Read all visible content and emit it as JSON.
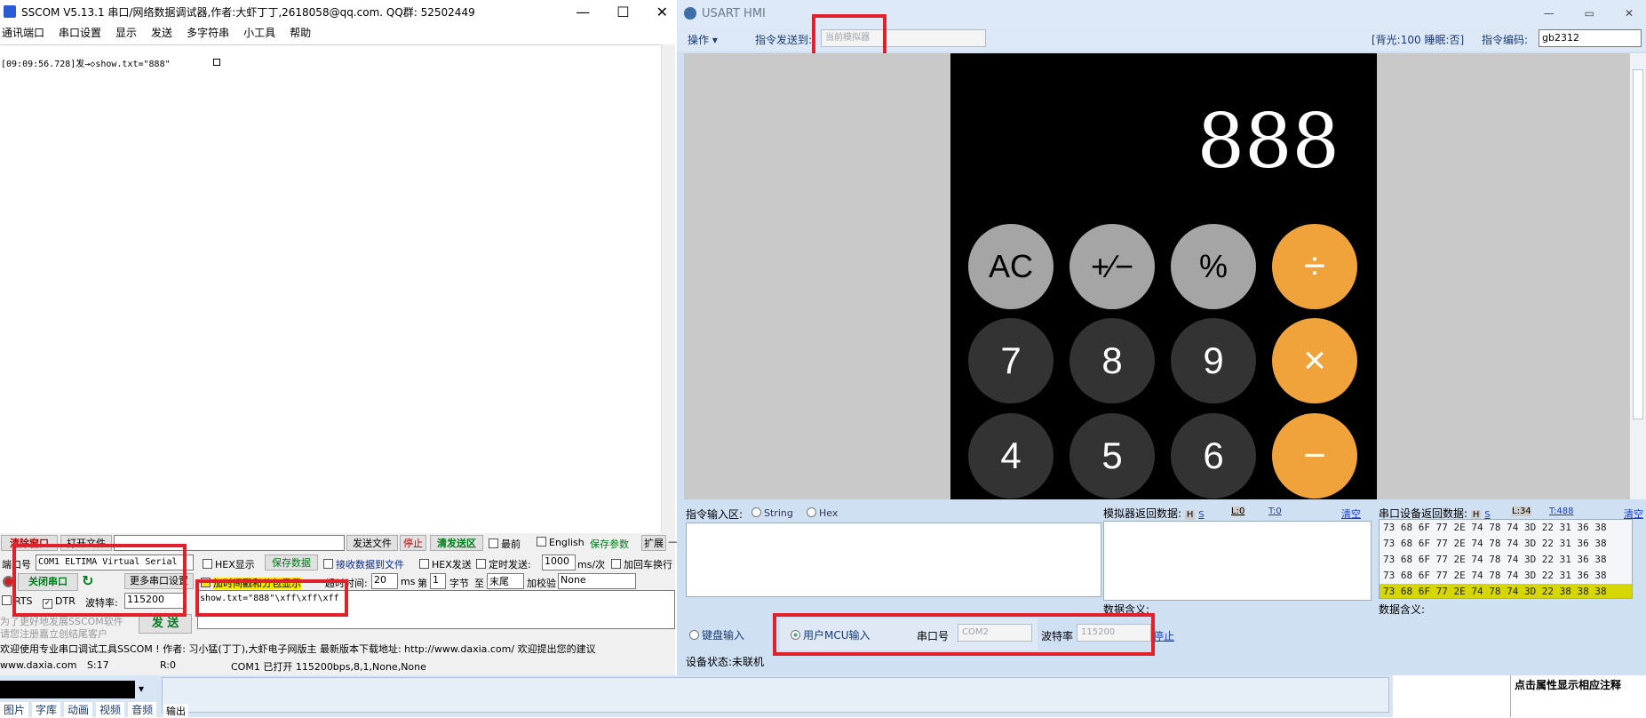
{
  "sscom": {
    "title": "SSCOM V5.13.1 串口/网络数据调试器,作者:大虾丁丁,2618058@qq.com. QQ群: 52502449",
    "menu": [
      "通讯端口",
      "串口设置",
      "显示",
      "发送",
      "多字符串",
      "小工具",
      "帮助"
    ],
    "recv_line": "[09:09:56.728]发→◇show.txt=\"888\"",
    "row1": {
      "clear_window": "清除窗口",
      "open_file": "打开文件",
      "send_file": "发送文件",
      "stop": "停止",
      "clear_send": "清发送区",
      "topmost": "最前",
      "english": "English",
      "save_params": "保存参数",
      "expand": "扩展",
      "dash": "—"
    },
    "port_label": "端口号",
    "port_value": "COM1 ELTIMA Virtual Serial",
    "hex_display": "HEX显示",
    "save_data": "保存数据",
    "recv_to_file": "接收数据到文件",
    "hex_send": "HEX发送",
    "timed_send": "定时发送:",
    "timed_value": "1000",
    "timed_unit": "ms/次",
    "add_crlf": "加回车换行",
    "close_port": "关闭串口",
    "more_settings": "更多串口设置",
    "timestamp_label": "加时间戳和分包显示",
    "timeout_label": "超时时间:",
    "timeout_value": "20",
    "ms": "ms",
    "byte_prefix": "第",
    "byte_value": "1",
    "byte_suffix": "字节",
    "to": "至",
    "to_value": "末尾",
    "checksum_label": "加校验",
    "checksum_value": "None",
    "rts": "RTS",
    "dtr": "DTR",
    "baud_label": "波特率:",
    "baud_value": "115200",
    "send_text": "show.txt=\"888\"\\xff\\xff\\xff",
    "send_button": "发 送",
    "promo1": "为了更好地发展SSCOM软件",
    "promo2": "请您注册嘉立创结尾客户",
    "ticker": "欢迎使用专业串口调试工具SSCOM !  作者: 习小猛(丁丁),大虾电子网版主  最新版本下载地址: http://www.daxia.com/  欢迎提出您的建议",
    "status": {
      "site": "www.daxia.com",
      "sent": "S:17",
      "recv": "R:0",
      "port_state": "COM1 已打开  115200bps,8,1,None,None"
    }
  },
  "hmi": {
    "title": "USART HMI",
    "toolbar": {
      "operate": "操作",
      "send_to_label": "指令发送到:",
      "send_to_value": "当前模拟器",
      "backlight": "[背光:100  睡眠:否]",
      "encoding_label": "指令编码:",
      "encoding_value": "gb2312"
    },
    "calculator": {
      "display": "888",
      "keys": [
        {
          "label": "AC",
          "style": "gray"
        },
        {
          "label": "+∕−",
          "style": "gray"
        },
        {
          "label": "%",
          "style": "gray"
        },
        {
          "label": "÷",
          "style": "orange"
        },
        {
          "label": "7",
          "style": "dark"
        },
        {
          "label": "8",
          "style": "dark"
        },
        {
          "label": "9",
          "style": "dark"
        },
        {
          "label": "×",
          "style": "orange"
        },
        {
          "label": "4",
          "style": "dark"
        },
        {
          "label": "5",
          "style": "dark"
        },
        {
          "label": "6",
          "style": "dark"
        },
        {
          "label": "−",
          "style": "orange"
        }
      ]
    },
    "cmd_input_label": "指令输入区:",
    "string_opt": "String",
    "hex_opt": "Hex",
    "sim_return_label": "模拟器返回数据:",
    "sim_h": "H",
    "sim_s": "S",
    "sim_l": "L:0",
    "sim_t": "T:0",
    "sim_clear": "清空",
    "sim_meaning": "数据含义:",
    "dev_return_label": "串口设备返回数据:",
    "dev_h": "H",
    "dev_s": "S",
    "dev_l": "L:34",
    "dev_t": "T:488",
    "dev_clear": "清空",
    "dev_meaning": "数据含义:",
    "hex_rows": [
      "73 68 6F 77 2E 74 78 74 3D 22 31 36 38",
      "73 68 6F 77 2E 74 78 74 3D 22 31 36 38",
      "73 68 6F 77 2E 74 78 74 3D 22 31 36 38",
      "73 68 6F 77 2E 74 78 74 3D 22 31 36 38",
      "73 68 6F 77 2E 74 78 74 3D 22 38 38 38"
    ],
    "keyboard_input": "键盘输入",
    "mcu_input": "用户MCU输入",
    "port_label": "串口号",
    "port_value": "COM2",
    "baud_label": "波特率",
    "baud_value": "115200",
    "stop_link": "停止",
    "device_status": "设备状态:未联机",
    "attr_note": "点击属性显示相应注释"
  },
  "taskbar": {
    "tabs": [
      "图片",
      "字库",
      "动画",
      "视频",
      "音频"
    ],
    "output": "输出"
  },
  "colors": {
    "highlight_red": "#e0202a",
    "calc_orange": "#f1a33b",
    "hex_highlight": "#d6d600"
  }
}
